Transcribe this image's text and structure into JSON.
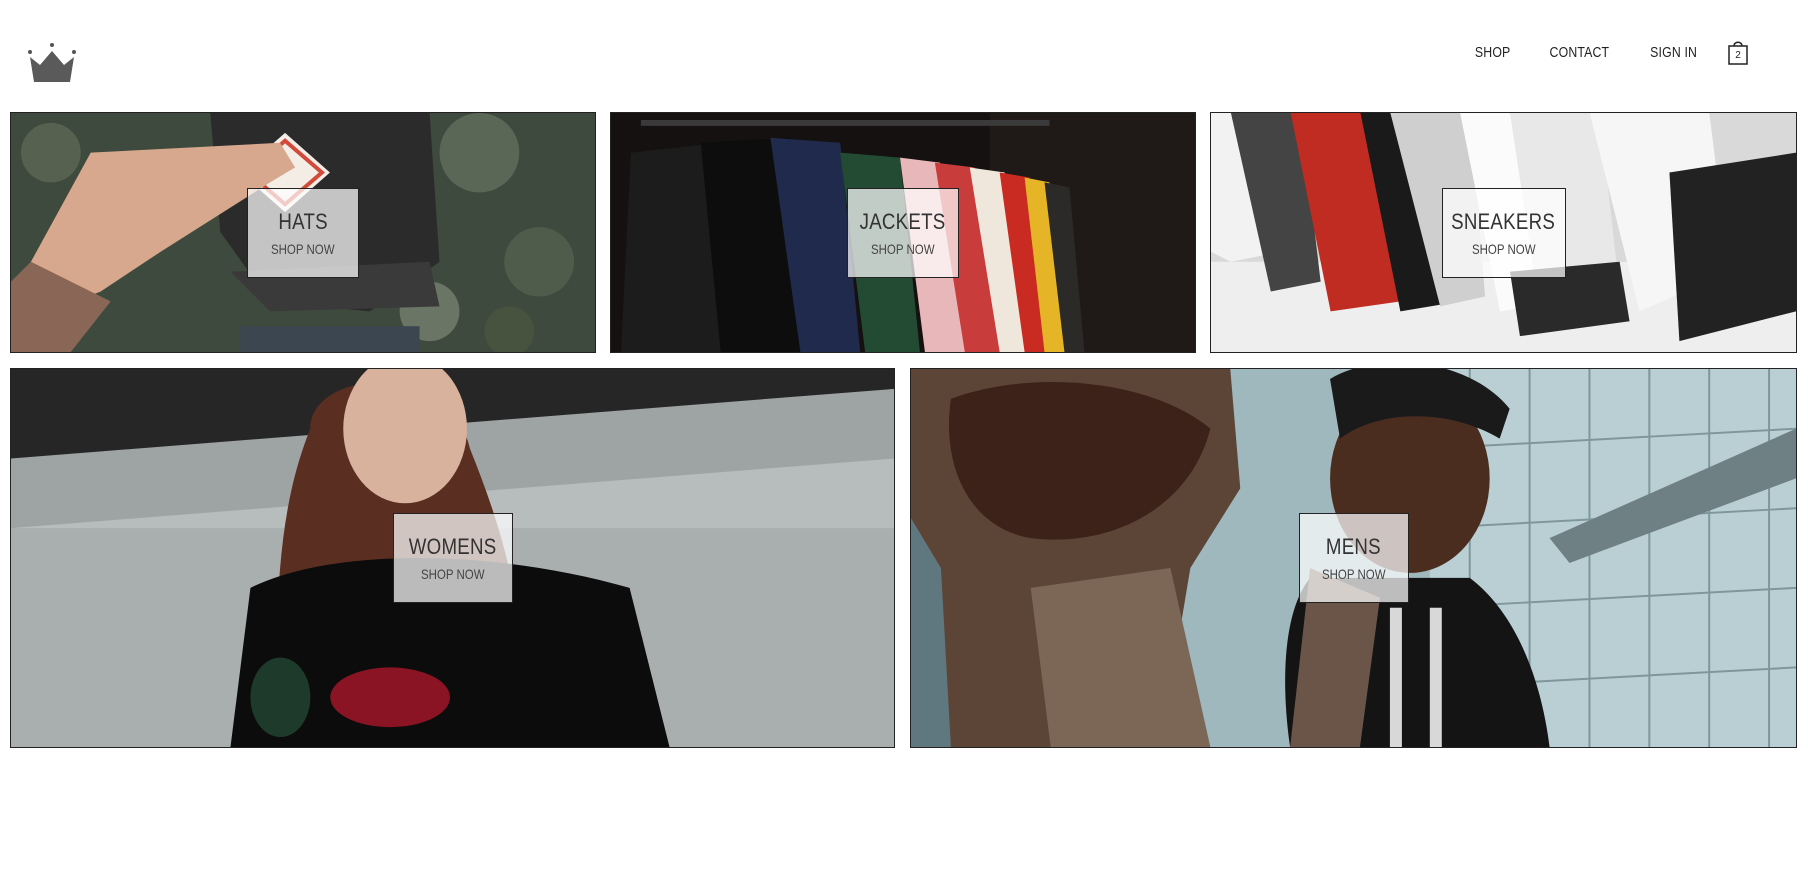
{
  "header": {
    "logo_icon": "crown-icon",
    "nav": [
      {
        "label": "SHOP"
      },
      {
        "label": "CONTACT"
      },
      {
        "label": "SIGN IN"
      }
    ],
    "cart": {
      "icon": "shopping-bag-icon",
      "count": "2"
    }
  },
  "categories": [
    {
      "title": "HATS",
      "cta": "SHOP NOW"
    },
    {
      "title": "JACKETS",
      "cta": "SHOP NOW"
    },
    {
      "title": "SNEAKERS",
      "cta": "SHOP NOW"
    },
    {
      "title": "WOMENS",
      "cta": "SHOP NOW"
    },
    {
      "title": "MENS",
      "cta": "SHOP NOW"
    }
  ]
}
